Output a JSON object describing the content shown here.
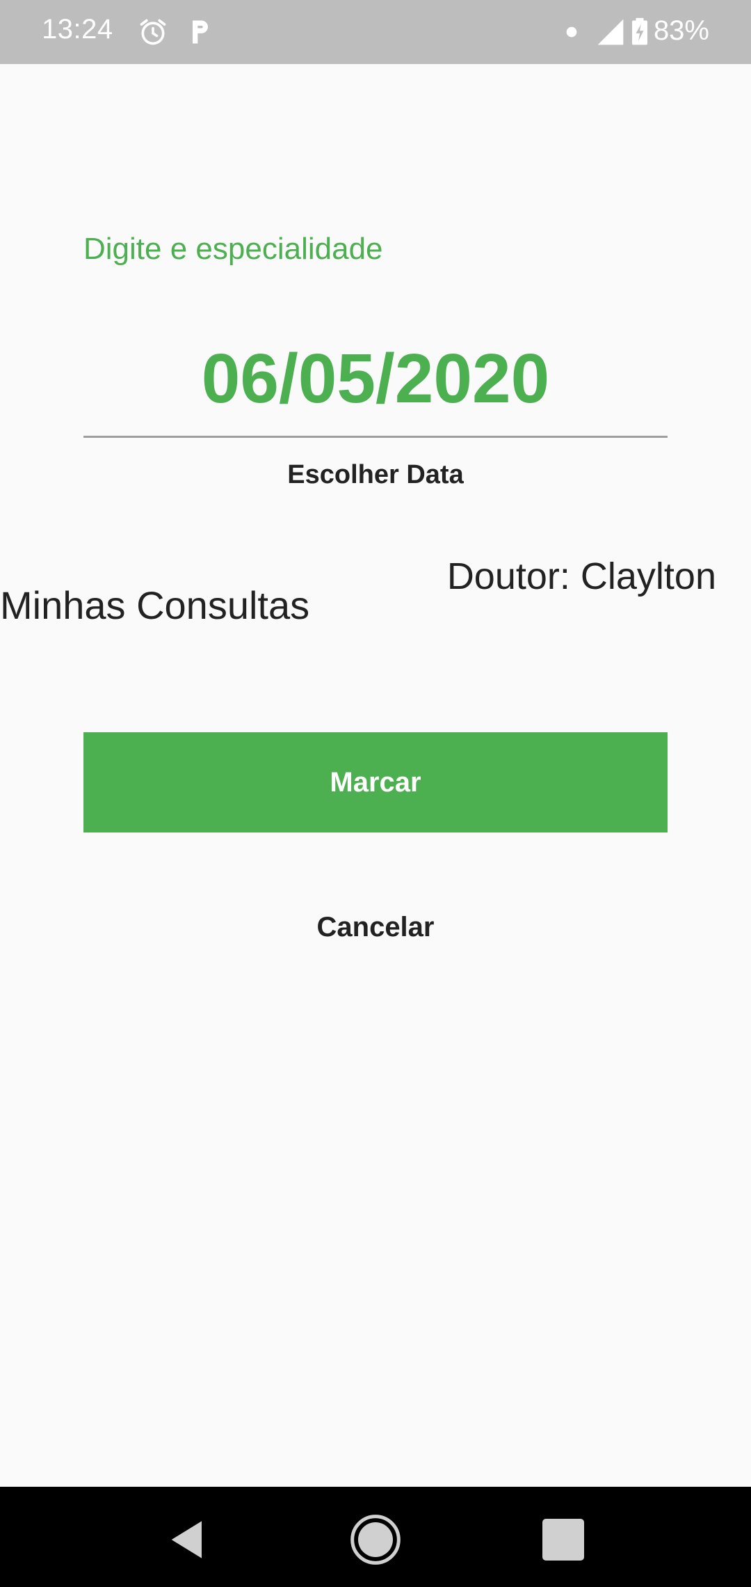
{
  "status_bar": {
    "time": "13:24",
    "battery_percent": "83%",
    "icons": [
      "alarm-icon",
      "parking-icon",
      "notification-dot-icon",
      "signal-icon",
      "battery-charging-icon"
    ]
  },
  "form": {
    "specialty_placeholder": "Digite e especialidade",
    "specialty_value": "",
    "date": "06/05/2020",
    "choose_date_label": "Escolher Data",
    "my_appointments_label": "Minhas Consultas",
    "doctor_label": "Doutor: Claylton",
    "submit_label": "Marcar",
    "cancel_label": "Cancelar"
  },
  "nav_bar": {
    "icons": [
      "back-icon",
      "home-icon",
      "recents-icon"
    ]
  },
  "colors": {
    "accent": "#4caf50",
    "status_bar": "#bdbdbd",
    "background": "#fafafa",
    "text": "#222222"
  }
}
